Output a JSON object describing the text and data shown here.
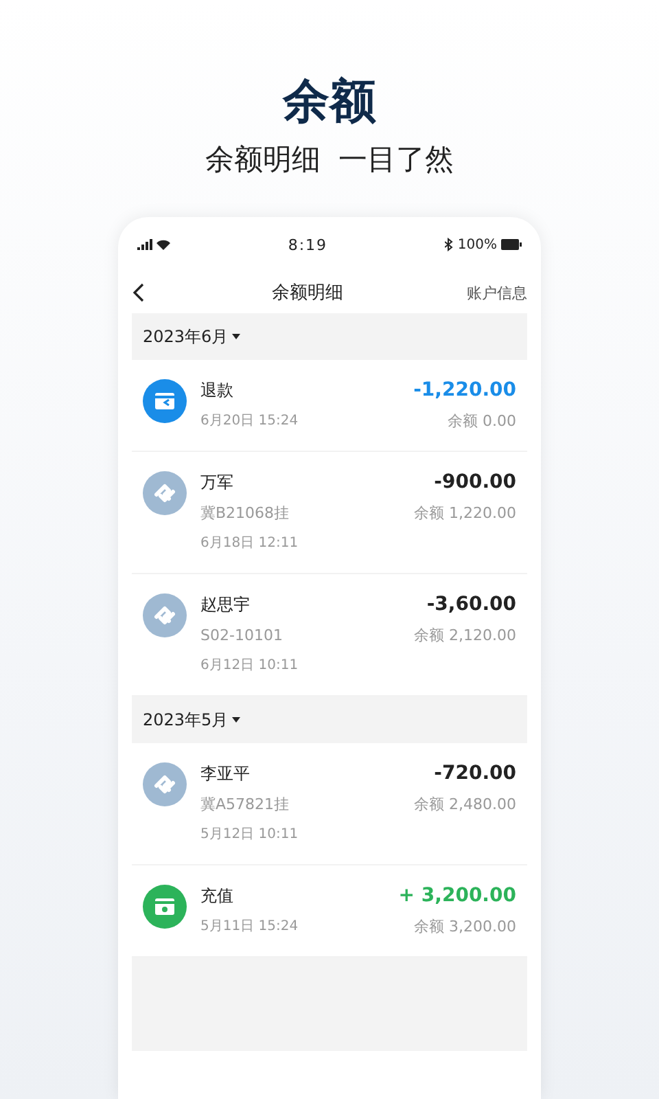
{
  "promo": {
    "title": "余额",
    "subtitle": "余额明细  一目了然"
  },
  "status_bar": {
    "time": "8:19",
    "battery": "100%"
  },
  "nav": {
    "title": "余额明细",
    "action": "账户信息"
  },
  "groups": [
    {
      "month": "2023年6月",
      "transactions": [
        {
          "kind": "refund",
          "name": "退款",
          "time": "6月20日 15:24",
          "amount": "-1,220.00",
          "balance": "余额 0.00"
        },
        {
          "kind": "transfer",
          "name": "万军",
          "plate": "冀B21068挂",
          "time": "6月18日 12:11",
          "amount": "-900.00",
          "balance": "余额 1,220.00"
        },
        {
          "kind": "transfer",
          "name": "赵思宇",
          "plate": "S02-10101",
          "time": "6月12日 10:11",
          "amount": "-3,60.00",
          "balance": "余额 2,120.00"
        }
      ]
    },
    {
      "month": "2023年5月",
      "transactions": [
        {
          "kind": "transfer",
          "name": "李亚平",
          "plate": "冀A57821挂",
          "time": "5月12日 10:11",
          "amount": "-720.00",
          "balance": "余额 2,480.00"
        },
        {
          "kind": "recharge",
          "name": "充值",
          "time": "5月11日 15:24",
          "amount": "+ 3,200.00",
          "balance": "余额 3,200.00"
        }
      ]
    }
  ]
}
